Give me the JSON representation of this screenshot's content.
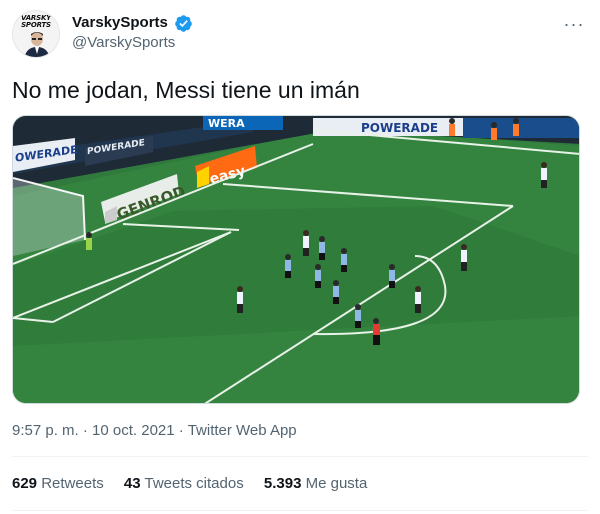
{
  "user": {
    "display_name": "VarskySports",
    "handle": "@VarskySports",
    "avatar_logo_line1": "VARSKY",
    "avatar_logo_line2": "SPORTS",
    "verified_icon": "verified-badge-icon",
    "verified_color": "#1d9bf0"
  },
  "menu": {
    "more_label": "···"
  },
  "tweet": {
    "text": "No me jodan, Messi tiene un imán",
    "time": "9:57 p. m.",
    "date": "10 oct. 2021",
    "source": "Twitter Web App",
    "separator": "·"
  },
  "media": {
    "ad_boards": [
      "WERA",
      "POWERADE",
      "OWERADE",
      "POWERADE",
      "easy",
      "GENROD"
    ]
  },
  "stats": [
    {
      "count": "629",
      "label": "Retweets"
    },
    {
      "count": "43",
      "label": "Tweets citados"
    },
    {
      "count": "5.393",
      "label": "Me gusta"
    }
  ],
  "colors": {
    "text": "#0f1419",
    "secondary": "#536471",
    "divider": "#eff3f4",
    "pitch": "#2f7a3c"
  }
}
